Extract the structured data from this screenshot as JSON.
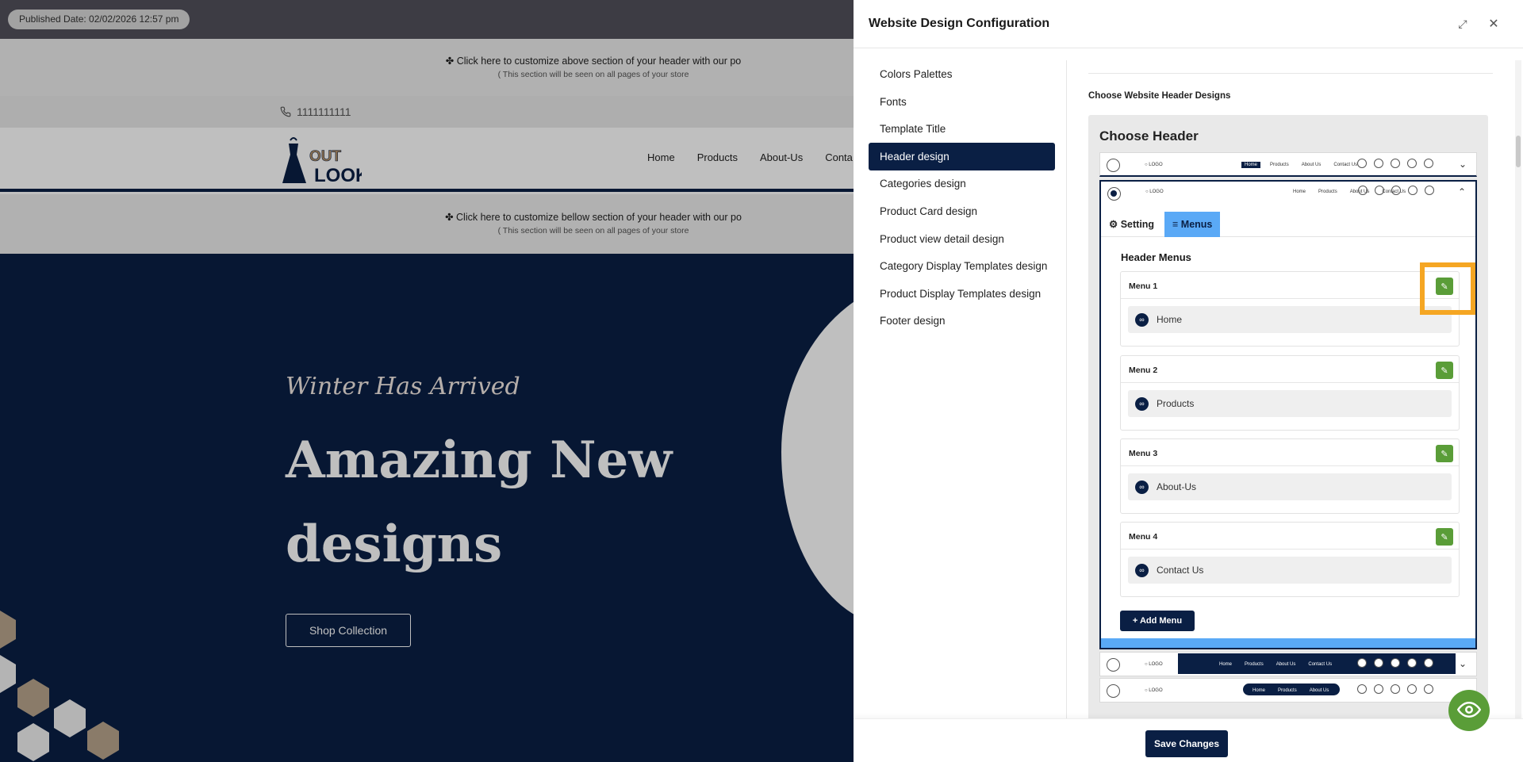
{
  "preview": {
    "published_date": "Published Date: 02/02/2026 12:57 pm",
    "customize_above": "✤ Click here to customize above section of your header with our po",
    "customize_above_sub": "( This section will be seen on all pages of your store",
    "phone": "1111111111",
    "logo_text_top": "OUT",
    "logo_text_bottom": "LOOK",
    "nav": [
      "Home",
      "Products",
      "About-Us",
      "Conta"
    ],
    "customize_below": "✤ Click here to customize bellow section of your header with our po",
    "customize_below_sub": "( This section will be seen on all pages of your store",
    "hero_tag": "Winter Has Arrived",
    "hero_headline": "Amazing New designs",
    "shop_button": "Shop Collection"
  },
  "panel": {
    "title": "Website Design Configuration",
    "sidebar": [
      "Colors Palettes",
      "Fonts",
      "Template Title",
      "Header design",
      "Categories design",
      "Product Card design",
      "Product view detail design",
      "Category Display Templates design",
      "Product Display Templates design",
      "Footer design"
    ],
    "active_sidebar": "Header design",
    "section_title": "Choose Website Header Designs",
    "choose_header": "Choose Header",
    "mini": {
      "logo": "○ LOGO",
      "nav": [
        "Home",
        "Products",
        "About Us",
        "Contact Us"
      ],
      "icons": [
        "search-icon",
        "help-icon",
        "cart-icon",
        "notification-icon",
        "profile-icon"
      ]
    },
    "tabs": {
      "setting": "Setting",
      "menus": "Menus"
    },
    "header_menus_title": "Header Menus",
    "menus": [
      {
        "label": "Menu 1",
        "item": "Home"
      },
      {
        "label": "Menu 2",
        "item": "Products"
      },
      {
        "label": "Menu 3",
        "item": "About-Us"
      },
      {
        "label": "Menu 4",
        "item": "Contact Us"
      }
    ],
    "add_menu": "+ Add Menu",
    "save_changes": "Save Changes"
  },
  "colors": {
    "navy": "#0a1f44",
    "green": "#5a9d38",
    "tab_blue": "#5aa9f6",
    "highlight": "#f5a623"
  }
}
